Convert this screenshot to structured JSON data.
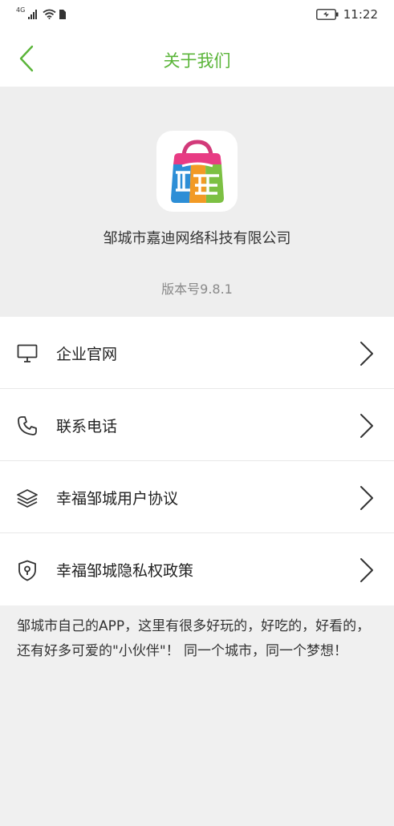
{
  "status_bar": {
    "network_label": "4G",
    "time": "11:22"
  },
  "header": {
    "title": "关于我们",
    "back_icon": "chevron-left-icon"
  },
  "about": {
    "company_name": "邹城市嘉迪网络科技有限公司",
    "version": "版本号9.8.1"
  },
  "menu": {
    "items": [
      {
        "label": "企业官网",
        "icon": "monitor-icon"
      },
      {
        "label": "联系电话",
        "icon": "phone-icon"
      },
      {
        "label": "幸福邹城用户协议",
        "icon": "layers-icon"
      },
      {
        "label": "幸福邹城隐私权政策",
        "icon": "shield-icon"
      }
    ]
  },
  "description": "邹城市自己的APP，这里有很多好玩的，好吃的，好看的，还有好多可爱的\"小伙伴\"！ 同一个城市，同一个梦想！",
  "colors": {
    "accent": "#5bb53a",
    "background": "#f0f0f0",
    "card": "#ffffff"
  }
}
